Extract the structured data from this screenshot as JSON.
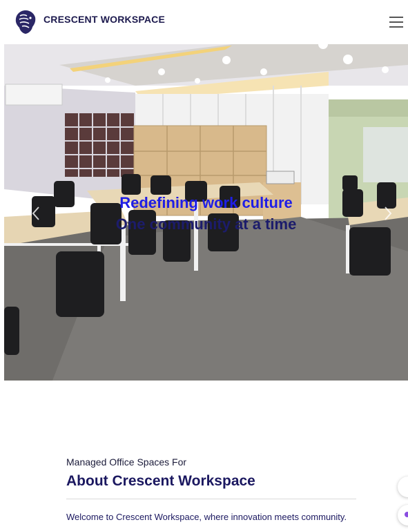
{
  "header": {
    "brand": "CRESCENT WORKSPACE",
    "logo_icon": "lion-head-icon",
    "menu_icon": "hamburger-menu-icon"
  },
  "hero": {
    "line1": "Redefining work culture",
    "line2": "One community at a time",
    "prev_icon": "chevron-left-icon",
    "next_icon": "chevron-right-icon"
  },
  "about": {
    "subtitle": "Managed Office Spaces For",
    "title": "About Crescent Workspace",
    "text": "Welcome to Crescent Workspace, where innovation meets community."
  },
  "colors": {
    "brand_navy": "#1d1a4e",
    "hero_line1": "#1f1ee6",
    "hero_line2": "#1c1c6b"
  }
}
